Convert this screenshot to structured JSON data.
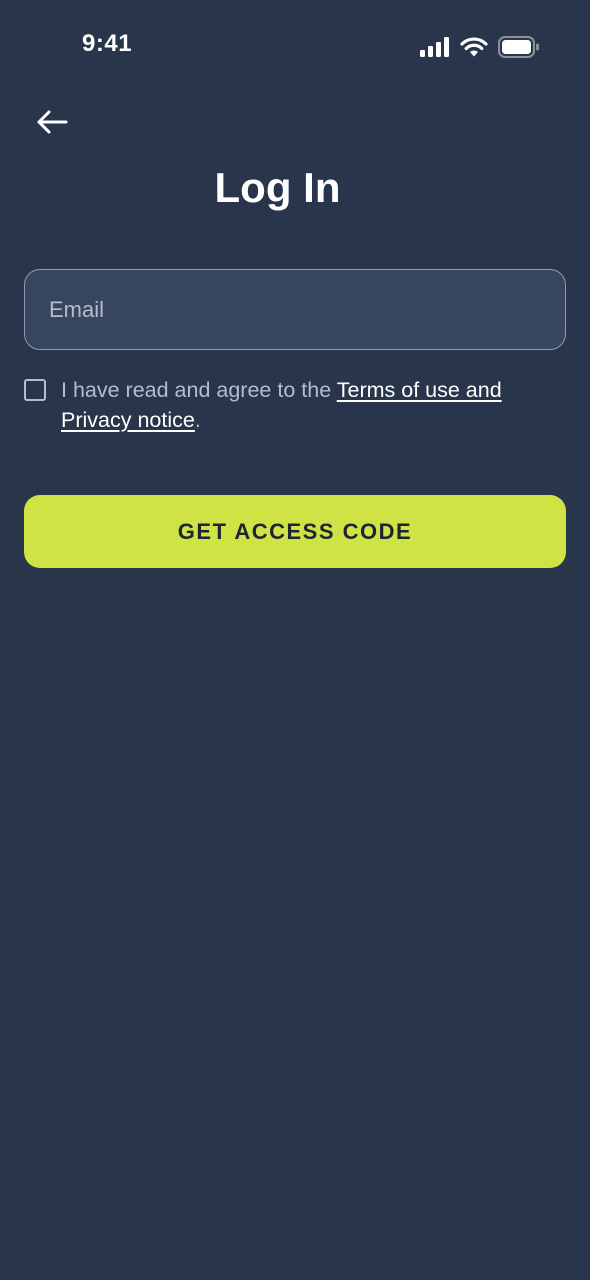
{
  "status_bar": {
    "time": "9:41",
    "icons": [
      "cellular-signal-icon",
      "wifi-icon",
      "battery-icon"
    ]
  },
  "header": {
    "back_icon": "arrow-left-icon",
    "title": "Log In"
  },
  "form": {
    "email_placeholder": "Email",
    "email_value": "",
    "agreement": {
      "checked": false,
      "text_before": "I have read and agree to the ",
      "link_text_line1": "Terms of use and",
      "link_text_line2": "Privacy notice",
      "text_after": "."
    },
    "submit_label": "GET ACCESS CODE"
  },
  "colors": {
    "background": "#29354a",
    "input_background": "#37465e",
    "input_border": "#8f9cb2",
    "muted_text": "#b3bdcc",
    "accent": "#cfe444",
    "accent_text": "#1d2533"
  }
}
